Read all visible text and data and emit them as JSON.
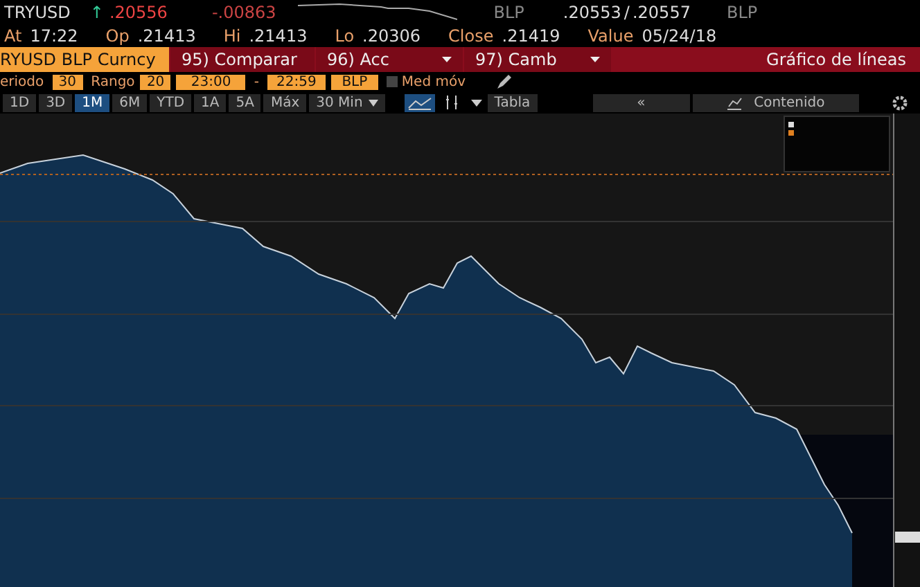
{
  "quote": {
    "ticker": "TRYUSD",
    "arrow": "↑",
    "last": ".20556",
    "change": "-.00863",
    "source_left": "BLP",
    "bid": ".20553",
    "slash": "/",
    "ask": ".20557",
    "source_right": "BLP"
  },
  "stats": [
    {
      "label": "At",
      "value": "17:22"
    },
    {
      "label": "Op",
      "value": ".21413"
    },
    {
      "label": "Hi",
      "value": ".21413"
    },
    {
      "label": "Lo",
      "value": ".20306"
    },
    {
      "label": "Close",
      "value": ".21419"
    },
    {
      "label": "Value",
      "value": "05/24/18"
    }
  ],
  "command_bar": {
    "security": "RYUSD BLP Curncy",
    "actions": [
      {
        "number": "95)",
        "label": "Comparar",
        "dropdown": false
      },
      {
        "number": "96)",
        "label": "Acc",
        "dropdown": true
      },
      {
        "number": "97)",
        "label": "Camb",
        "dropdown": true
      }
    ],
    "title": "Gráfico de líneas"
  },
  "settings": {
    "period_label": "eriodo",
    "period": "30",
    "range_label": "Rango",
    "range": "20",
    "start": "23:00",
    "dash": "-",
    "end": "22:59",
    "source": "BLP",
    "moving_average": {
      "label": "Med móv",
      "checked": false
    }
  },
  "ranges": [
    {
      "label": "1D",
      "selected": false
    },
    {
      "label": "3D",
      "selected": false
    },
    {
      "label": "1M",
      "selected": true
    },
    {
      "label": "6M",
      "selected": false
    },
    {
      "label": "YTD",
      "selected": false
    },
    {
      "label": "1A",
      "selected": false
    },
    {
      "label": "5A",
      "selected": false
    },
    {
      "label": "Máx",
      "selected": false
    }
  ],
  "interval": "30 Min",
  "table_label": "Tabla",
  "collapse": "«",
  "content_label": "Contenido"
}
